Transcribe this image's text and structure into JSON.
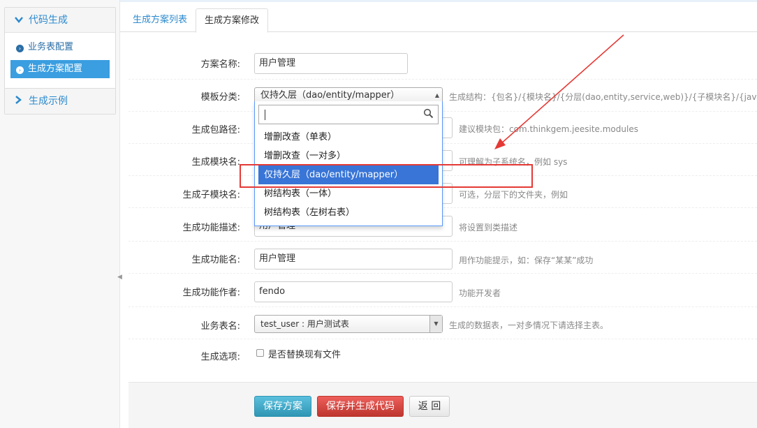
{
  "sidebar": {
    "group1": {
      "title": "代码生成",
      "items": [
        {
          "label": "业务表配置"
        },
        {
          "label": "生成方案配置"
        }
      ]
    },
    "group2": {
      "title": "生成示例"
    }
  },
  "tabs": [
    {
      "label": "生成方案列表"
    },
    {
      "label": "生成方案修改"
    }
  ],
  "form": {
    "scheme_name": {
      "label": "方案名称:",
      "value": "用户管理"
    },
    "template_category": {
      "label": "模板分类:",
      "selected": "仅持久层（dao/entity/mapper）",
      "help": "生成结构：{包名}/{模块名}/{分层(dao,entity,service,web)}/{子模块名}/{java类}",
      "search_value": "",
      "options": [
        "增删改查（单表）",
        "增删改查（一对多）",
        "仅持久层（dao/entity/mapper）",
        "树结构表（一体）",
        "树结构表（左树右表）"
      ]
    },
    "package_path": {
      "label": "生成包路径:",
      "help": "建议模块包：com.thinkgem.jeesite.modules"
    },
    "module_name": {
      "label": "生成模块名:",
      "help": "可理解为子系统名，例如 sys"
    },
    "sub_module_name": {
      "label": "生成子模块名:",
      "help": "可选，分层下的文件夹，例如"
    },
    "function_desc": {
      "label": "生成功能描述:",
      "value": "用户管理",
      "help": "将设置到类描述"
    },
    "function_name": {
      "label": "生成功能名:",
      "value": "用户管理",
      "help": "用作功能提示，如：保存“某某”成功"
    },
    "function_author": {
      "label": "生成功能作者:",
      "value": "fendo",
      "help": "功能开发者"
    },
    "table_name": {
      "label": "业务表名:",
      "value": "test_user : 用户测试表",
      "help": "生成的数据表，一对多情况下请选择主表。"
    },
    "options": {
      "label": "生成选项:",
      "replace_label": "是否替换现有文件",
      "replace_checked": false
    }
  },
  "buttons": {
    "save": "保存方案",
    "save_generate": "保存并生成代码",
    "back": "返 回"
  },
  "colors": {
    "link": "#2b8ace",
    "active": "#3a9ee0",
    "highlight": "#3875d7",
    "annotation": "#e53935"
  }
}
